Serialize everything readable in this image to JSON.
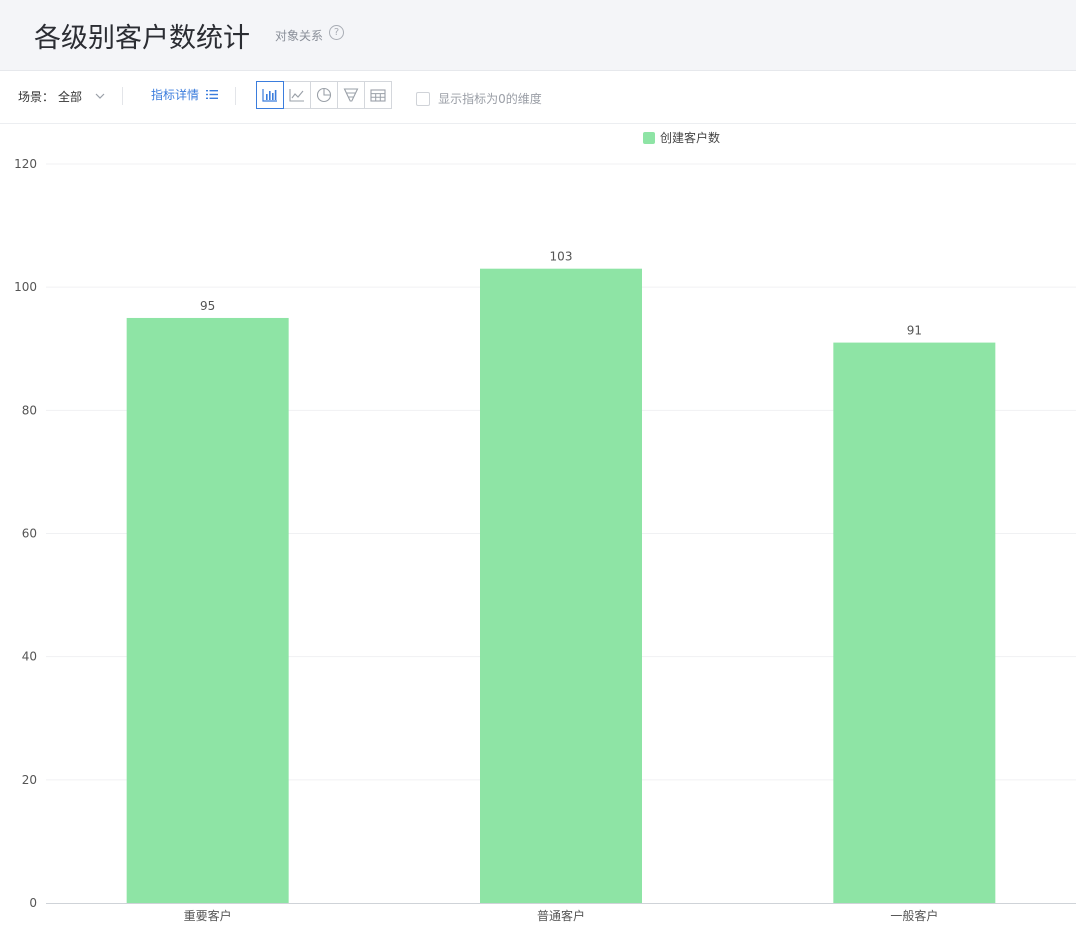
{
  "header": {
    "title": "各级别客户数统计",
    "relation_label": "对象关系",
    "help_glyph": "?"
  },
  "toolbar": {
    "scene_label": "场景：",
    "scene_value": "全部",
    "metric_detail_label": "指标详情",
    "chart_type_buttons": [
      "bar-chart-icon",
      "line-chart-icon",
      "pie-chart-icon",
      "funnel-chart-icon",
      "table-icon"
    ],
    "active_chart_type": "bar-chart-icon",
    "show_zero_label": "显示指标为0的维度",
    "show_zero_checked": false
  },
  "colors": {
    "bar": "#8ee4a5",
    "accent": "#3b7ddd",
    "grid": "#f0f1f3",
    "axis_text": "#555555"
  },
  "chart_data": {
    "type": "bar",
    "categories": [
      "重要客户",
      "普通客户",
      "一般客户"
    ],
    "series": [
      {
        "name": "创建客户数",
        "values": [
          95,
          103,
          91
        ]
      }
    ],
    "ylim": [
      0,
      120
    ],
    "yticks": [
      0,
      20,
      40,
      60,
      80,
      100,
      120
    ],
    "grid": true,
    "legend_position": "top-center",
    "data_labels": true
  }
}
